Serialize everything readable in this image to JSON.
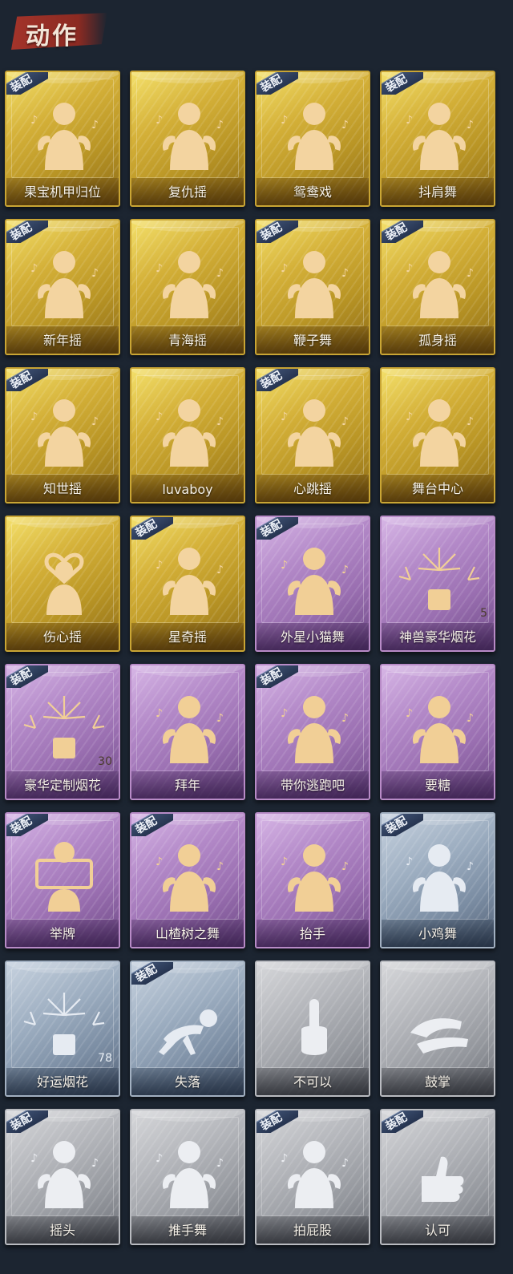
{
  "header": {
    "title": "动作"
  },
  "badge_text": "装配",
  "cards": [
    {
      "label": "果宝机甲归位",
      "style": "gold",
      "equipped": true,
      "icon": "dancer-icon"
    },
    {
      "label": "复仇摇",
      "style": "gold",
      "equipped": false,
      "icon": "dancer-icon"
    },
    {
      "label": "鸳鸯戏",
      "style": "gold",
      "equipped": true,
      "icon": "dancer-icon"
    },
    {
      "label": "抖肩舞",
      "style": "gold",
      "equipped": true,
      "icon": "dancer-icon"
    },
    {
      "label": "新年摇",
      "style": "gold",
      "equipped": true,
      "icon": "dancer-icon"
    },
    {
      "label": "青海摇",
      "style": "gold",
      "equipped": false,
      "icon": "dancer-icon"
    },
    {
      "label": "鞭子舞",
      "style": "gold",
      "equipped": true,
      "icon": "dancer-icon"
    },
    {
      "label": "孤身摇",
      "style": "gold",
      "equipped": true,
      "icon": "dancer-icon"
    },
    {
      "label": "知世摇",
      "style": "gold",
      "equipped": true,
      "icon": "dancer-icon"
    },
    {
      "label": "luvaboy",
      "style": "gold",
      "equipped": false,
      "icon": "dancer-icon"
    },
    {
      "label": "心跳摇",
      "style": "gold",
      "equipped": true,
      "icon": "dancer-icon"
    },
    {
      "label": "舞台中心",
      "style": "gold",
      "equipped": false,
      "icon": "dancer-icon"
    },
    {
      "label": "伤心摇",
      "style": "gold",
      "equipped": false,
      "icon": "heart-hands-icon"
    },
    {
      "label": "星奇摇",
      "style": "gold",
      "equipped": true,
      "icon": "dancer-icon"
    },
    {
      "label": "外星小猫舞",
      "style": "purple",
      "equipped": true,
      "icon": "dancer-icon"
    },
    {
      "label": "神兽豪华烟花",
      "style": "purple",
      "equipped": false,
      "icon": "fireworks-icon",
      "count": "5"
    },
    {
      "label": "豪华定制烟花",
      "style": "purple",
      "equipped": true,
      "icon": "fireworks-icon",
      "count": "30"
    },
    {
      "label": "拜年",
      "style": "purple",
      "equipped": false,
      "icon": "dancer-icon"
    },
    {
      "label": "带你逃跑吧",
      "style": "purple",
      "equipped": true,
      "icon": "dancer-icon"
    },
    {
      "label": "要糖",
      "style": "purple",
      "equipped": false,
      "icon": "dancer-icon"
    },
    {
      "label": "举牌",
      "style": "purple",
      "equipped": true,
      "icon": "sign-icon"
    },
    {
      "label": "山楂树之舞",
      "style": "purple",
      "equipped": true,
      "icon": "dancer-icon"
    },
    {
      "label": "抬手",
      "style": "purple",
      "equipped": false,
      "icon": "dancer-icon"
    },
    {
      "label": "小鸡舞",
      "style": "blue",
      "equipped": true,
      "icon": "dancer-icon"
    },
    {
      "label": "好运烟花",
      "style": "blue",
      "equipped": false,
      "icon": "fireworks-icon",
      "count": "78"
    },
    {
      "label": "失落",
      "style": "blue",
      "equipped": true,
      "icon": "crawl-icon"
    },
    {
      "label": "不可以",
      "style": "gray",
      "equipped": false,
      "icon": "finger-icon"
    },
    {
      "label": "鼓掌",
      "style": "gray",
      "equipped": false,
      "icon": "clap-icon"
    },
    {
      "label": "摇头",
      "style": "gray",
      "equipped": true,
      "icon": "dancer-icon"
    },
    {
      "label": "推手舞",
      "style": "gray",
      "equipped": false,
      "icon": "dancer-icon"
    },
    {
      "label": "拍屁股",
      "style": "gray",
      "equipped": true,
      "icon": "dancer-icon"
    },
    {
      "label": "认可",
      "style": "gray",
      "equipped": true,
      "icon": "thumbs-up-icon"
    }
  ]
}
